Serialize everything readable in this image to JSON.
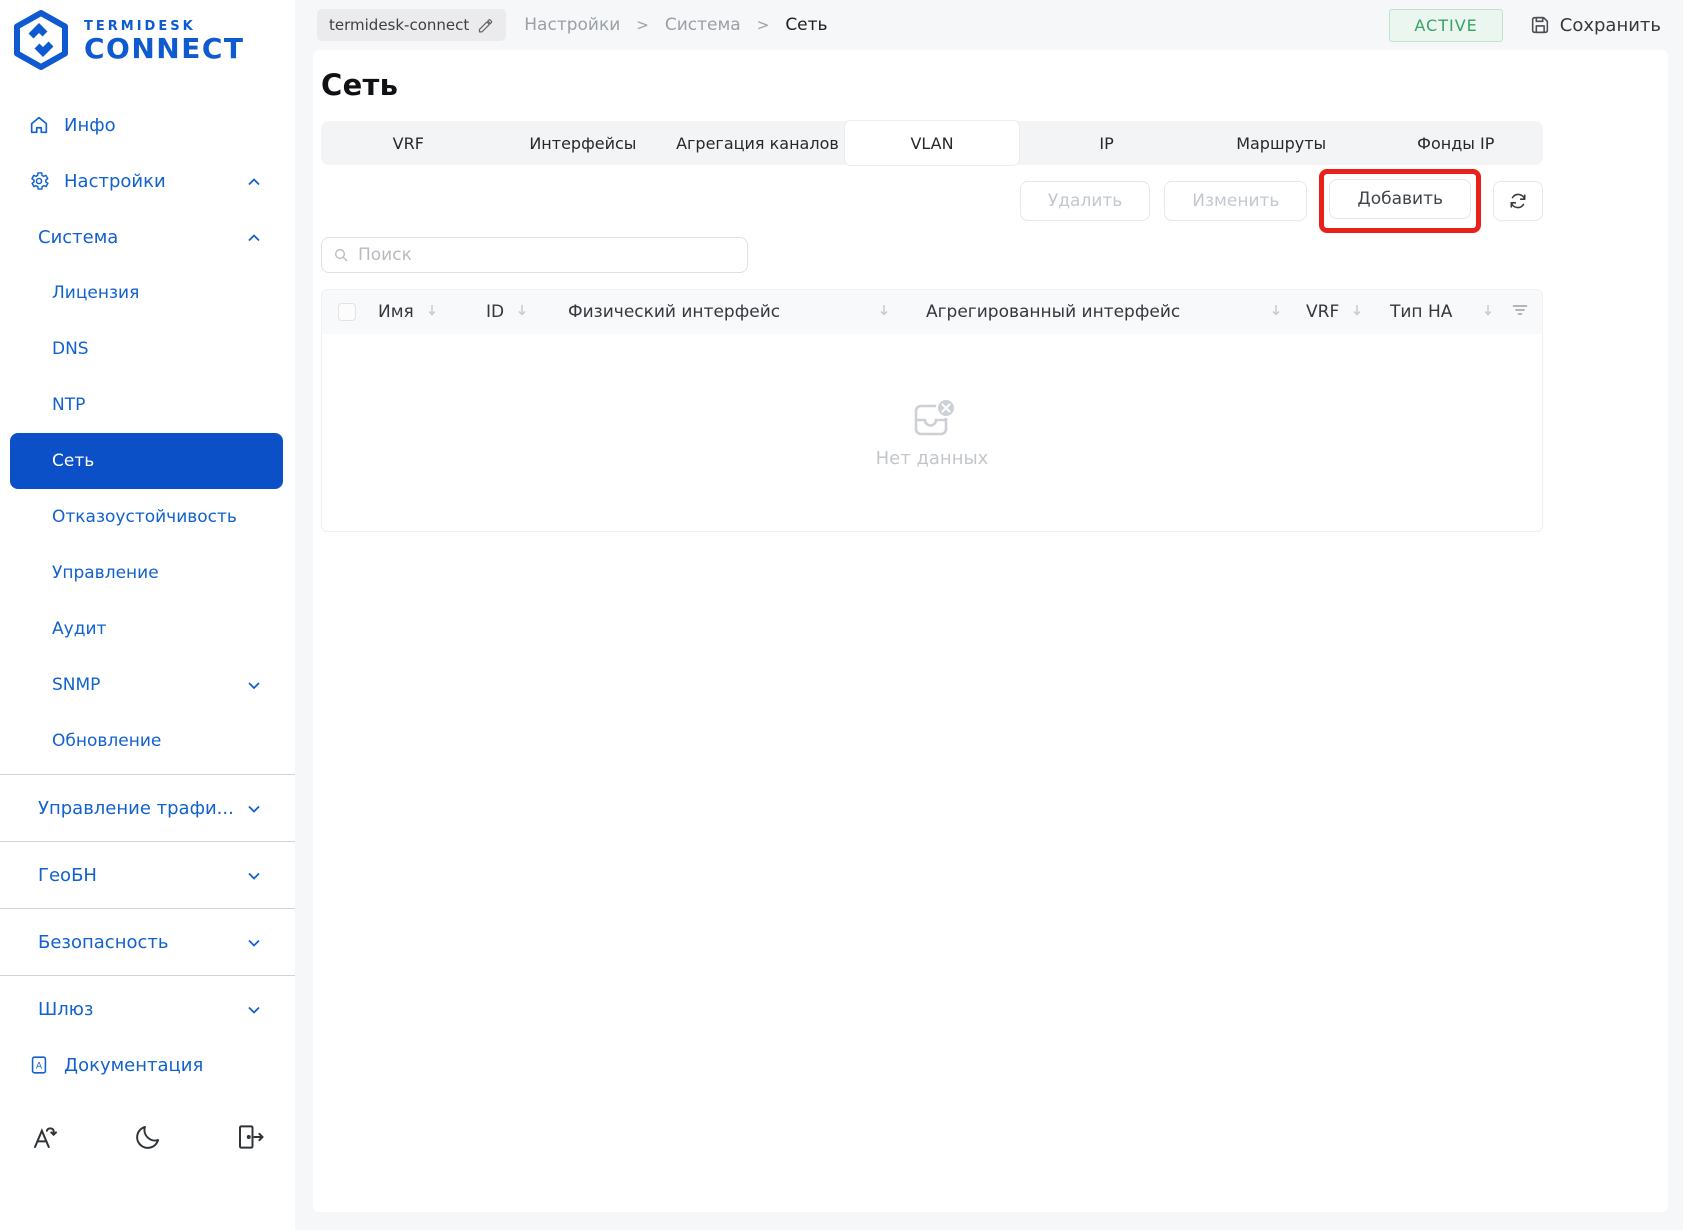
{
  "brand": {
    "line1": "TERMIDESK",
    "line2": "CONNECT"
  },
  "sidebar": {
    "items": [
      {
        "label": "Инфо",
        "icon": "home-icon"
      },
      {
        "label": "Настройки",
        "icon": "gear-icon",
        "chevron": "up"
      },
      {
        "label": "Система",
        "chevron": "up"
      },
      {
        "label": "Лицензия"
      },
      {
        "label": "DNS"
      },
      {
        "label": "NTP"
      },
      {
        "label": "Сеть",
        "selected": true
      },
      {
        "label": "Отказоустойчивость"
      },
      {
        "label": "Управление"
      },
      {
        "label": "Аудит"
      },
      {
        "label": "SNMP",
        "chevron": "down"
      },
      {
        "label": "Обновление"
      },
      {
        "label": "Управление трафи...",
        "chevron": "down"
      },
      {
        "label": "ГеоБН",
        "chevron": "down"
      },
      {
        "label": "Безопасность",
        "chevron": "down"
      },
      {
        "label": "Шлюз",
        "chevron": "down"
      },
      {
        "label": "Документация",
        "icon": "book-icon"
      }
    ],
    "footer_icons": [
      "language-icon",
      "dark-mode-icon",
      "logout-icon"
    ]
  },
  "header": {
    "hostname_chip": "termidesk-connect",
    "breadcrumb": [
      "Настройки",
      "Система",
      "Сеть"
    ],
    "breadcrumb_separator": ">",
    "status_badge": "ACTIVE",
    "save_label": "Сохранить"
  },
  "page": {
    "title": "Сеть",
    "tabs": [
      "VRF",
      "Интерфейсы",
      "Агрегация каналов",
      "VLAN",
      "IP",
      "Маршруты",
      "Фонды IP"
    ],
    "active_tab": "VLAN",
    "toolbar": {
      "delete_label": "Удалить",
      "edit_label": "Изменить",
      "add_label": "Добавить"
    },
    "search": {
      "placeholder": "Поиск"
    },
    "table": {
      "columns": [
        "Имя",
        "ID",
        "Физический интерфейс",
        "Агрегированный интерфейс",
        "VRF",
        "Тип HA"
      ],
      "rows": [],
      "empty_text": "Нет данных"
    }
  },
  "colors": {
    "brand_blue": "#0d5ad1",
    "sidebar_link": "#1161cf",
    "selected_item_bg": "#0c50c8",
    "badge_green": "#35a564",
    "annotation_red": "#e8211a",
    "page_bg": "#f6f7f8"
  }
}
